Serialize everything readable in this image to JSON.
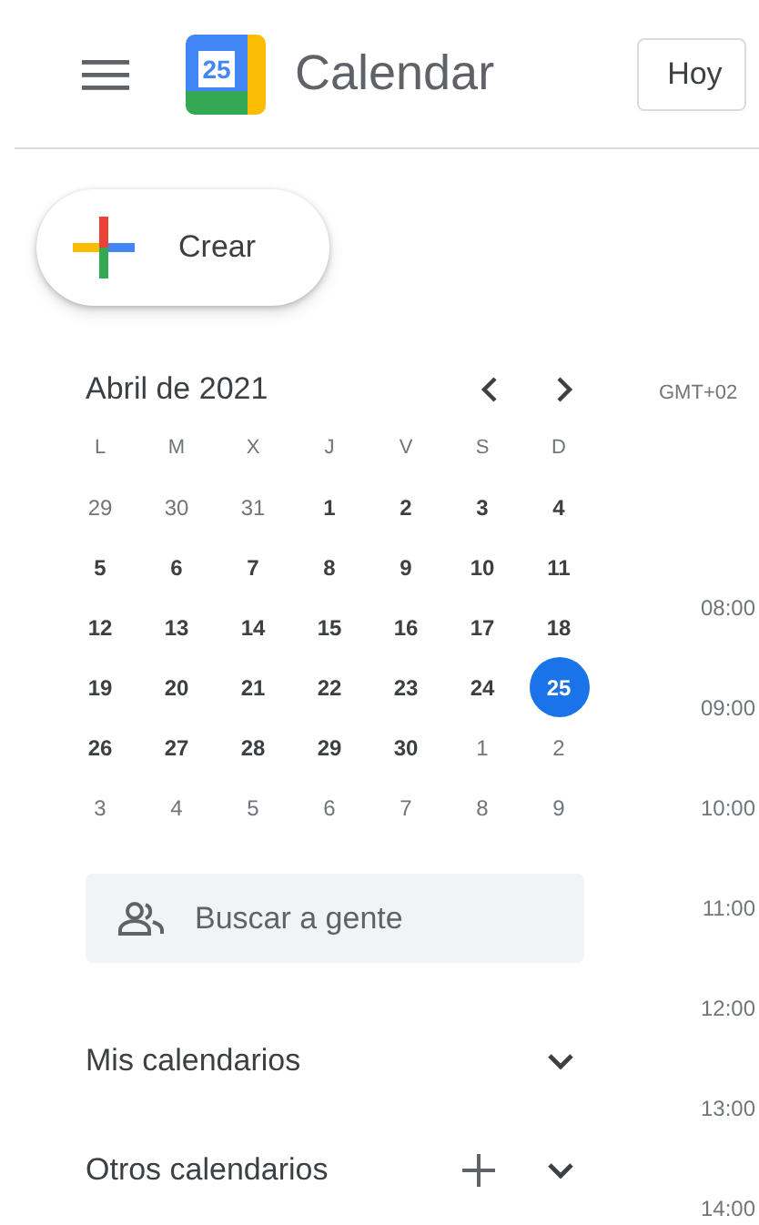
{
  "header": {
    "app_name": "Calendar",
    "logo_day": "25",
    "today_button": "Hoy"
  },
  "create_button": "Crear",
  "mini_calendar": {
    "title": "Abril de 2021",
    "weekdays": [
      "L",
      "M",
      "X",
      "J",
      "V",
      "S",
      "D"
    ],
    "weeks": [
      [
        {
          "day": "29",
          "outside": true,
          "selected": false
        },
        {
          "day": "30",
          "outside": true,
          "selected": false
        },
        {
          "day": "31",
          "outside": true,
          "selected": false
        },
        {
          "day": "1",
          "outside": false,
          "selected": false
        },
        {
          "day": "2",
          "outside": false,
          "selected": false
        },
        {
          "day": "3",
          "outside": false,
          "selected": false
        },
        {
          "day": "4",
          "outside": false,
          "selected": false
        }
      ],
      [
        {
          "day": "5",
          "outside": false,
          "selected": false
        },
        {
          "day": "6",
          "outside": false,
          "selected": false
        },
        {
          "day": "7",
          "outside": false,
          "selected": false
        },
        {
          "day": "8",
          "outside": false,
          "selected": false
        },
        {
          "day": "9",
          "outside": false,
          "selected": false
        },
        {
          "day": "10",
          "outside": false,
          "selected": false
        },
        {
          "day": "11",
          "outside": false,
          "selected": false
        }
      ],
      [
        {
          "day": "12",
          "outside": false,
          "selected": false
        },
        {
          "day": "13",
          "outside": false,
          "selected": false
        },
        {
          "day": "14",
          "outside": false,
          "selected": false
        },
        {
          "day": "15",
          "outside": false,
          "selected": false
        },
        {
          "day": "16",
          "outside": false,
          "selected": false
        },
        {
          "day": "17",
          "outside": false,
          "selected": false
        },
        {
          "day": "18",
          "outside": false,
          "selected": false
        }
      ],
      [
        {
          "day": "19",
          "outside": false,
          "selected": false
        },
        {
          "day": "20",
          "outside": false,
          "selected": false
        },
        {
          "day": "21",
          "outside": false,
          "selected": false
        },
        {
          "day": "22",
          "outside": false,
          "selected": false
        },
        {
          "day": "23",
          "outside": false,
          "selected": false
        },
        {
          "day": "24",
          "outside": false,
          "selected": false
        },
        {
          "day": "25",
          "outside": false,
          "selected": true
        }
      ],
      [
        {
          "day": "26",
          "outside": false,
          "selected": false
        },
        {
          "day": "27",
          "outside": false,
          "selected": false
        },
        {
          "day": "28",
          "outside": false,
          "selected": false
        },
        {
          "day": "29",
          "outside": false,
          "selected": false
        },
        {
          "day": "30",
          "outside": false,
          "selected": false
        },
        {
          "day": "1",
          "outside": true,
          "selected": false
        },
        {
          "day": "2",
          "outside": true,
          "selected": false
        }
      ],
      [
        {
          "day": "3",
          "outside": true,
          "selected": false
        },
        {
          "day": "4",
          "outside": true,
          "selected": false
        },
        {
          "day": "5",
          "outside": true,
          "selected": false
        },
        {
          "day": "6",
          "outside": true,
          "selected": false
        },
        {
          "day": "7",
          "outside": true,
          "selected": false
        },
        {
          "day": "8",
          "outside": true,
          "selected": false
        },
        {
          "day": "9",
          "outside": true,
          "selected": false
        }
      ]
    ]
  },
  "people_search": {
    "placeholder": "Buscar a gente"
  },
  "sections": [
    {
      "label": "Mis calendarios",
      "has_add": false
    },
    {
      "label": "Otros calendarios",
      "has_add": true
    }
  ],
  "timezone": "GMT+02",
  "hours": [
    "08:00",
    "09:00",
    "10:00",
    "11:00",
    "12:00",
    "13:00",
    "14:00"
  ]
}
